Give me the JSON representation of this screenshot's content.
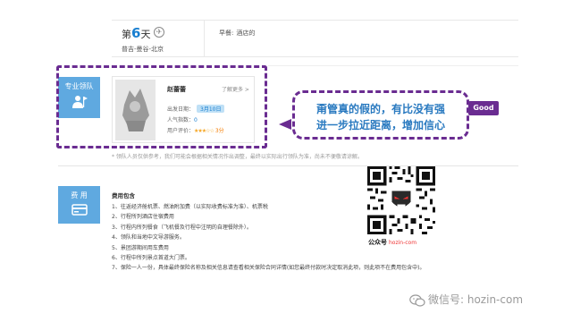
{
  "day": {
    "prefix": "第",
    "number": "6",
    "suffix": "天",
    "route": "普吉-曼谷-北京",
    "meals": [
      "早餐:",
      "酒店的"
    ]
  },
  "leader_section": {
    "tab_label": "专业领队",
    "name": "赵蕾蕾",
    "more_link": "了解更多 >",
    "date_label": "出发日期：",
    "date_value": "3月10日",
    "popularity_label": "人气指数：",
    "popularity_value": "0",
    "rating_label": "用户评价：",
    "stars": "★★★☆☆",
    "score": "3分"
  },
  "callout": {
    "line1": "甭管真的假的，有比没有强",
    "line2": "进一步拉近距离，增加信心"
  },
  "badge": {
    "label": "Good"
  },
  "footnote": "* 领队人员仅供参考，我们可能会根据相关情况作出调整，最终以实际出行领队为准，尚未不便敬请谅解。",
  "cost_section": {
    "tab_label": "费 用",
    "title": "费用包含",
    "items": [
      "1、往返经济舱机票、燃油附加费（以实际收费标准为准）、机票税",
      "2、行程所列酒店住宿费用",
      "3、行程内所列餐食（飞机餐及行程中注明的自理餐除外）。",
      "4、领队和当地中文导游服务。",
      "5、景团游期间用车费用",
      "6、行程中所列景点首道大门票。",
      "7、保险一人一份，具体最终保险名称及相关信息请查看相关保险合同详情(如您最终付款时决定取消此项，则此项不在费用包含中)。"
    ]
  },
  "qr": {
    "label": "公众号",
    "handle": "hozin-com"
  },
  "watermark": {
    "text": "微信号: hozin-com"
  },
  "colors": {
    "accent_blue": "#5fa9e0",
    "purple": "#6a2c91",
    "callout_text": "#2a7ac0"
  }
}
